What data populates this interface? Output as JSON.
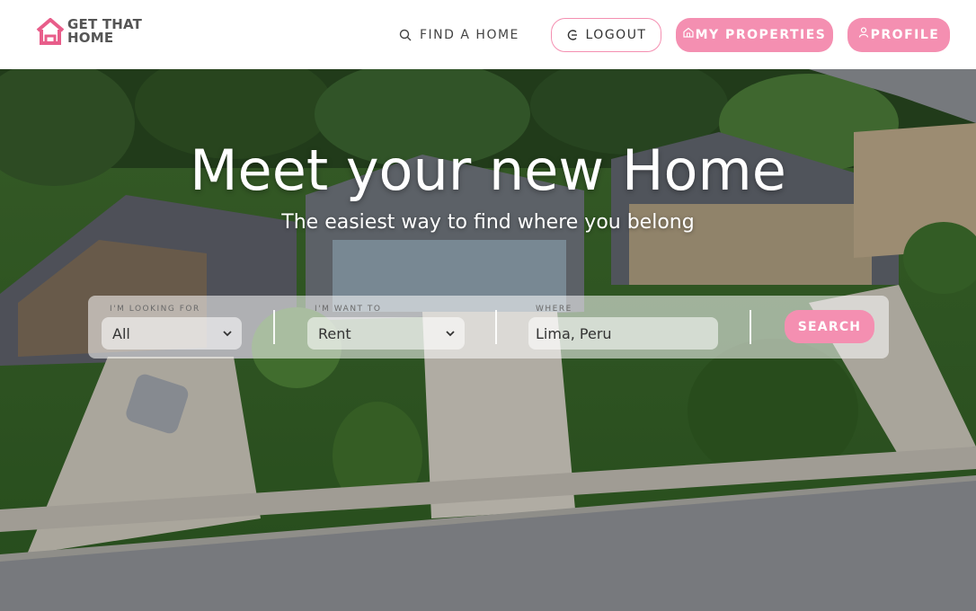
{
  "header": {
    "logo_line1": "GET THAT",
    "logo_line2": "HOME",
    "find_home": "FIND A HOME",
    "logout": "LOGOUT",
    "my_properties": "MY PROPERTIES",
    "profile": "PROFILE"
  },
  "hero": {
    "title": "Meet your new Home",
    "subtitle": "The easiest way to find where you belong"
  },
  "search": {
    "looking_for_label": "I'M LOOKING FOR",
    "looking_for_value": "All",
    "want_to_label": "I'M WANT TO",
    "want_to_value": "Rent",
    "where_label": "WHERE",
    "where_value": "Lima, Peru",
    "button": "SEARCH"
  },
  "colors": {
    "accent": "#F48FB1",
    "logo_pink": "#E85D8A",
    "text_dark": "#444444"
  },
  "icons": {
    "logo": "house-outline-icon",
    "find": "search-icon",
    "logout": "logout-icon",
    "properties": "home-icon",
    "profile": "user-icon",
    "select": "chevron-down-icon"
  }
}
